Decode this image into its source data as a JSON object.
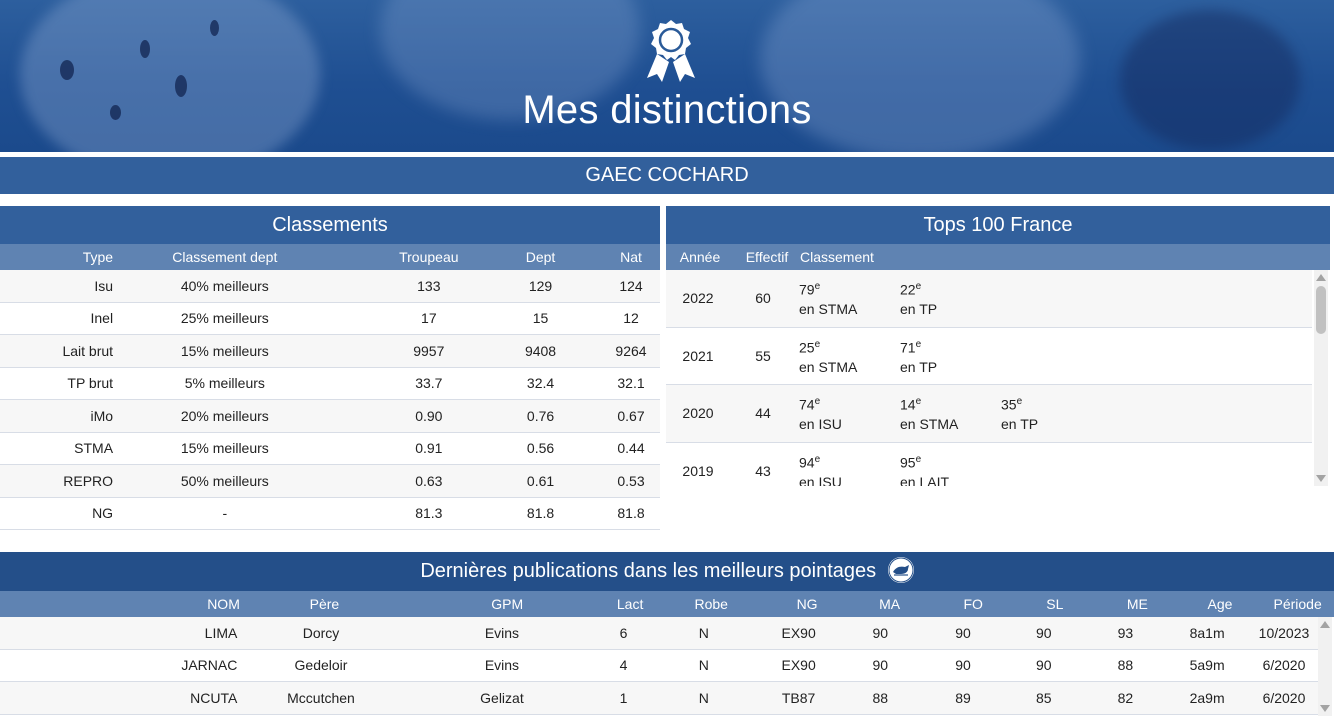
{
  "hero": {
    "title": "Mes distinctions",
    "icon": "award-ribbon-icon"
  },
  "farm": {
    "name": "GAEC COCHARD"
  },
  "classements": {
    "title": "Classements",
    "columns": [
      "Type",
      "Classement dept",
      "Troupeau",
      "Dept",
      "Nat"
    ],
    "rows": [
      {
        "type": "Isu",
        "classement": "40% meilleurs",
        "troupeau": "133",
        "dept": "129",
        "nat": "124"
      },
      {
        "type": "Inel",
        "classement": "25% meilleurs",
        "troupeau": "17",
        "dept": "15",
        "nat": "12"
      },
      {
        "type": "Lait brut",
        "classement": "15% meilleurs",
        "troupeau": "9957",
        "dept": "9408",
        "nat": "9264"
      },
      {
        "type": "TP brut",
        "classement": "5% meilleurs",
        "troupeau": "33.7",
        "dept": "32.4",
        "nat": "32.1"
      },
      {
        "type": "iMo",
        "classement": "20% meilleurs",
        "troupeau": "0.90",
        "dept": "0.76",
        "nat": "0.67"
      },
      {
        "type": "STMA",
        "classement": "15% meilleurs",
        "troupeau": "0.91",
        "dept": "0.56",
        "nat": "0.44"
      },
      {
        "type": "REPRO",
        "classement": "50% meilleurs",
        "troupeau": "0.63",
        "dept": "0.61",
        "nat": "0.53"
      },
      {
        "type": "NG",
        "classement": "-",
        "troupeau": "81.3",
        "dept": "81.8",
        "nat": "81.8"
      }
    ]
  },
  "tops": {
    "title": "Tops 100 France",
    "columns": [
      "Année",
      "Effectif",
      "Classement"
    ],
    "rows": [
      {
        "annee": "2022",
        "effectif": "60",
        "ranks": [
          {
            "rank": "79",
            "sup": "e",
            "label": "en STMA"
          },
          {
            "rank": "22",
            "sup": "e",
            "label": "en TP"
          }
        ]
      },
      {
        "annee": "2021",
        "effectif": "55",
        "ranks": [
          {
            "rank": "25",
            "sup": "e",
            "label": "en STMA"
          },
          {
            "rank": "71",
            "sup": "e",
            "label": "en TP"
          }
        ]
      },
      {
        "annee": "2020",
        "effectif": "44",
        "ranks": [
          {
            "rank": "74",
            "sup": "e",
            "label": "en ISU"
          },
          {
            "rank": "14",
            "sup": "e",
            "label": "en STMA"
          },
          {
            "rank": "35",
            "sup": "e",
            "label": "en TP"
          }
        ]
      },
      {
        "annee": "2019",
        "effectif": "43",
        "ranks": [
          {
            "rank": "94",
            "sup": "e",
            "label": "en ISU"
          },
          {
            "rank": "95",
            "sup": "e",
            "label": "en LAIT"
          }
        ]
      }
    ]
  },
  "publications": {
    "title": "Dernières publications dans les meilleurs pointages",
    "logo_icon": "cow-logo-icon",
    "columns": [
      "NOM",
      "Père",
      "GPM",
      "Lact",
      "Robe",
      "NG",
      "MA",
      "FO",
      "SL",
      "ME",
      "Age",
      "Période"
    ],
    "rows": [
      {
        "nom": "LIMA",
        "pere": "Dorcy",
        "gpm": "Evins",
        "lact": "6",
        "robe": "N",
        "ng": "EX90",
        "ma": "90",
        "fo": "90",
        "sl": "90",
        "me": "93",
        "age": "8a1m",
        "periode": "10/2023"
      },
      {
        "nom": "JARNAC",
        "pere": "Gedeloir",
        "gpm": "Evins",
        "lact": "4",
        "robe": "N",
        "ng": "EX90",
        "ma": "90",
        "fo": "90",
        "sl": "90",
        "me": "88",
        "age": "5a9m",
        "periode": "6/2020"
      },
      {
        "nom": "NCUTA",
        "pere": "Mccutchen",
        "gpm": "Gelizat",
        "lact": "1",
        "robe": "N",
        "ng": "TB87",
        "ma": "88",
        "fo": "89",
        "sl": "85",
        "me": "82",
        "age": "2a9m",
        "periode": "6/2020"
      }
    ]
  },
  "colors": {
    "hero_bg": "#1f4f92",
    "bar_bg": "#32609c",
    "header_bg": "#5f83b2",
    "pub_title_bg": "#244f89"
  }
}
